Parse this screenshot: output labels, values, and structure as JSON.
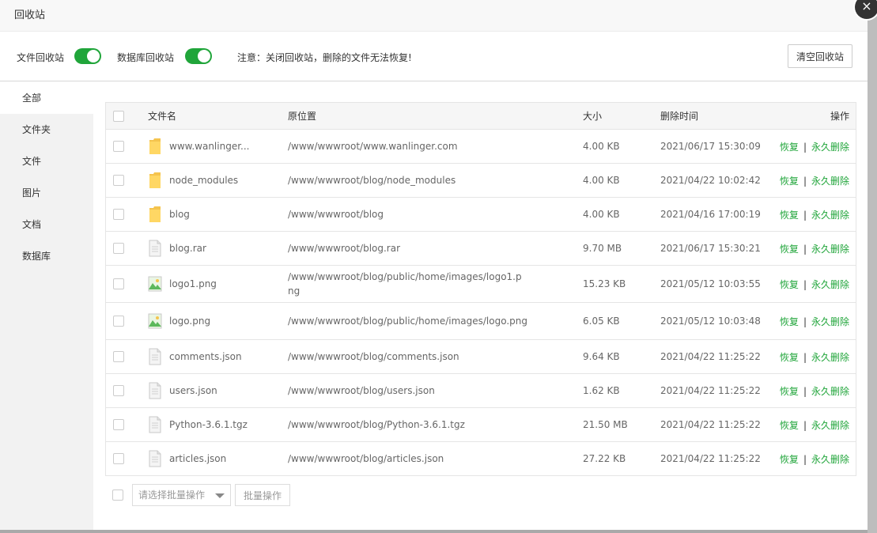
{
  "dialog": {
    "title": "回收站",
    "close_glyph": "×"
  },
  "settings": {
    "file_recycle_label": "文件回收站",
    "file_recycle_on": true,
    "db_recycle_label": "数据库回收站",
    "db_recycle_on": true,
    "notice": "注意：关闭回收站，删除的文件无法恢复!",
    "clear_label": "清空回收站"
  },
  "sidebar": {
    "items": [
      {
        "label": "全部",
        "active": true
      },
      {
        "label": "文件夹",
        "active": false
      },
      {
        "label": "文件",
        "active": false
      },
      {
        "label": "图片",
        "active": false
      },
      {
        "label": "文档",
        "active": false
      },
      {
        "label": "数据库",
        "active": false
      }
    ]
  },
  "table": {
    "headers": {
      "name": "文件名",
      "path": "原位置",
      "size": "大小",
      "time": "删除时间",
      "op": "操作"
    },
    "restore_label": "恢复",
    "separator": "|",
    "delete_label": "永久删除",
    "rows": [
      {
        "icon": "folder-icon",
        "name": "www.wanlinger...",
        "path": "/www/wwwroot/www.wanlinger.com",
        "size": "4.00 KB",
        "time": "2021/06/17 15:30:09"
      },
      {
        "icon": "folder-icon",
        "name": "node_modules",
        "path": "/www/wwwroot/blog/node_modules",
        "size": "4.00 KB",
        "time": "2021/04/22 10:02:42"
      },
      {
        "icon": "folder-icon",
        "name": "blog",
        "path": "/www/wwwroot/blog",
        "size": "4.00 KB",
        "time": "2021/04/16 17:00:19"
      },
      {
        "icon": "file-icon",
        "name": "blog.rar",
        "path": "/www/wwwroot/blog.rar",
        "size": "9.70 MB",
        "time": "2021/06/17 15:30:21"
      },
      {
        "icon": "image-icon",
        "name": "logo1.png",
        "path": "/www/wwwroot/blog/public/home/images/logo1.png",
        "size": "15.23 KB",
        "time": "2021/05/12 10:03:55"
      },
      {
        "icon": "image-icon",
        "name": "logo.png",
        "path": "/www/wwwroot/blog/public/home/images/logo.png",
        "size": "6.05 KB",
        "time": "2021/05/12 10:03:48"
      },
      {
        "icon": "file-icon",
        "name": "comments.json",
        "path": "/www/wwwroot/blog/comments.json",
        "size": "9.64 KB",
        "time": "2021/04/22 11:25:22"
      },
      {
        "icon": "file-icon",
        "name": "users.json",
        "path": "/www/wwwroot/blog/users.json",
        "size": "1.62 KB",
        "time": "2021/04/22 11:25:22"
      },
      {
        "icon": "file-icon",
        "name": "Python-3.6.1.tgz",
        "path": "/www/wwwroot/blog/Python-3.6.1.tgz",
        "size": "21.50 MB",
        "time": "2021/04/22 11:25:22"
      },
      {
        "icon": "file-icon",
        "name": "articles.json",
        "path": "/www/wwwroot/blog/articles.json",
        "size": "27.22 KB",
        "time": "2021/04/22 11:25:22"
      }
    ]
  },
  "batch": {
    "select_placeholder": "请选择批量操作",
    "button_label": "批量操作"
  },
  "colors": {
    "accent": "#20a53a",
    "sidebar_bg": "#f2f2f2",
    "header_bg": "#f6f6f6"
  }
}
